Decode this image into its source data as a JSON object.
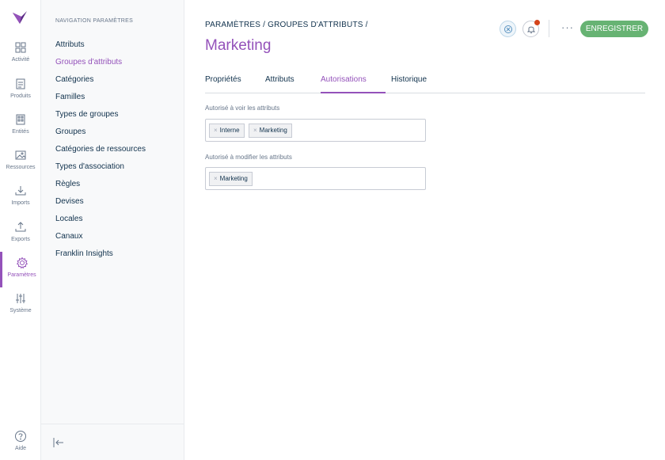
{
  "rail": {
    "items": [
      {
        "label": "Activité",
        "icon": "dashboard-icon"
      },
      {
        "label": "Produits",
        "icon": "products-icon"
      },
      {
        "label": "Entités",
        "icon": "entities-icon"
      },
      {
        "label": "Ressources",
        "icon": "assets-icon"
      },
      {
        "label": "Imports",
        "icon": "import-icon"
      },
      {
        "label": "Exports",
        "icon": "export-icon"
      },
      {
        "label": "Paramètres",
        "icon": "settings-icon",
        "active": true
      },
      {
        "label": "Système",
        "icon": "sliders-icon"
      }
    ],
    "help_label": "Aide"
  },
  "nav": {
    "title": "NAVIGATION PARAMÈTRES",
    "items": [
      "Attributs",
      "Groupes d'attributs",
      "Catégories",
      "Familles",
      "Types de groupes",
      "Groupes",
      "Catégories de ressources",
      "Types d'association",
      "Règles",
      "Devises",
      "Locales",
      "Canaux",
      "Franklin Insights"
    ],
    "active_index": 1
  },
  "header": {
    "breadcrumb": "PARAMÈTRES / GROUPES D'ATTRIBUTS /",
    "title": "Marketing",
    "more_label": "···",
    "save_label": "ENREGISTRER"
  },
  "tabs": [
    {
      "label": "Propriétés"
    },
    {
      "label": "Attributs"
    },
    {
      "label": "Autorisations",
      "active": true
    },
    {
      "label": "Historique"
    }
  ],
  "permissions": {
    "view": {
      "label": "Autorisé à voir les attributs",
      "tags": [
        "Interne",
        "Marketing"
      ]
    },
    "edit": {
      "label": "Autorisé à modifier les attributs",
      "tags": [
        "Marketing"
      ]
    }
  },
  "colors": {
    "accent": "#9452ba",
    "save": "#67b373",
    "notification": "#d4431a"
  }
}
